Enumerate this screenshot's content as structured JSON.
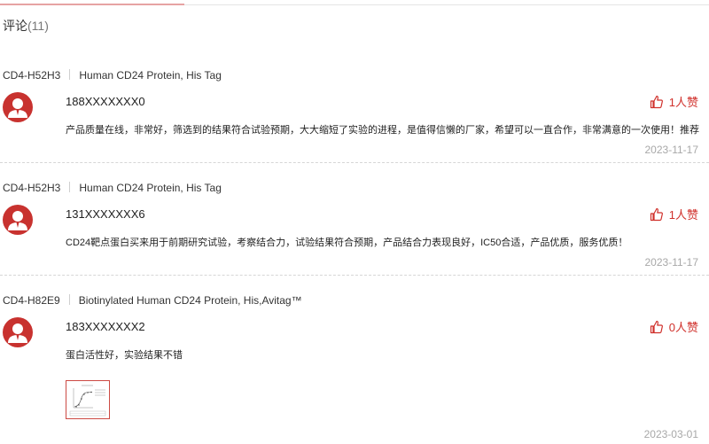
{
  "comments_header": {
    "label": "评论",
    "count": "(11)"
  },
  "reviews": [
    {
      "product_code": "CD4-H52H3",
      "product_name": "Human CD24 Protein, His Tag",
      "user": "188XXXXXXX0",
      "likes": "1人赞",
      "text": "产品质量在线，非常好，筛选到的结果符合试验预期，大大缩短了实验的进程，是值得信懒的厂家，希望可以一直合作，非常满意的一次使用！推荐",
      "date": "2023-11-17"
    },
    {
      "product_code": "CD4-H52H3",
      "product_name": "Human CD24 Protein, His Tag",
      "user": "131XXXXXXX6",
      "likes": "1人赞",
      "text": "CD24靶点蛋白买来用于前期研究试验，考察结合力，试验结果符合预期，产品结合力表现良好，IC50合适，产品优质，服务优质！",
      "date": "2023-11-17"
    },
    {
      "product_code": "CD4-H82E9",
      "product_name": "Biotinylated Human CD24 Protein, His,Avitag™",
      "user": "183XXXXXXX2",
      "likes": "0人赞",
      "text": "蛋白活性好，实验结果不错",
      "date": "2023-03-01"
    }
  ],
  "icons": {
    "avatar": "user-avatar-icon",
    "like": "thumbs-up-icon"
  },
  "colors": {
    "accent": "#d0302b",
    "avatar_bg": "#c8322f",
    "date": "#a8a8a8"
  }
}
